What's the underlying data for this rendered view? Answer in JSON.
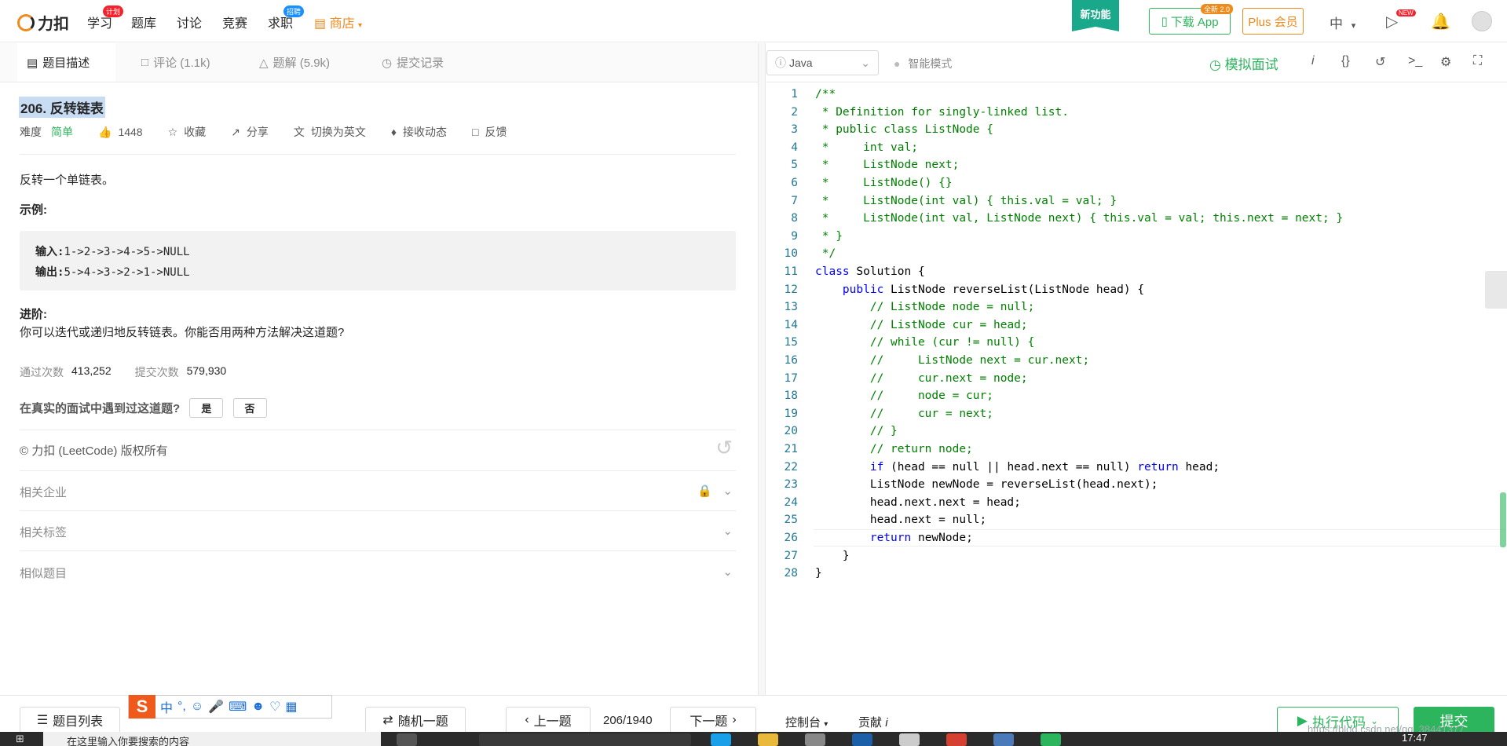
{
  "nav": {
    "logo": "力扣",
    "items": [
      {
        "label": "学习",
        "badge": "计划",
        "badge_color": "#f5222d"
      },
      {
        "label": "题库"
      },
      {
        "label": "讨论"
      },
      {
        "label": "竞赛"
      },
      {
        "label": "求职",
        "badge": "招聘",
        "badge_color": "#1890ff"
      }
    ],
    "shop": "商店",
    "new_feature": "新功能",
    "download_app": "下载 App",
    "download_badge": "全新 2.0",
    "plus": "Plus 会员",
    "language": "中",
    "new_badge": "NEW"
  },
  "tabs": [
    {
      "label": "题目描述",
      "icon": "description-icon"
    },
    {
      "label": "评论 (1.1k)",
      "icon": "comment-icon"
    },
    {
      "label": "题解 (5.9k)",
      "icon": "flask-icon"
    },
    {
      "label": "提交记录",
      "icon": "clock-icon"
    }
  ],
  "problem": {
    "title": "206. 反转链表",
    "difficulty_label": "难度",
    "difficulty": "简单",
    "likes": "1448",
    "actions": [
      "收藏",
      "分享",
      "切换为英文",
      "接收动态",
      "反馈"
    ],
    "description": "反转一个单链表。",
    "example_heading": "示例:",
    "input_label": "输入:",
    "input_value": "1->2->3->4->5->NULL",
    "output_label": "输出:",
    "output_value": "5->4->3->2->1->NULL",
    "advanced_heading": "进阶:",
    "advanced_text": "你可以迭代或递归地反转链表。你能否用两种方法解决这道题?",
    "accepted_label": "通过次数",
    "accepted_value": "413,252",
    "submissions_label": "提交次数",
    "submissions_value": "579,930",
    "interview_question": "在真实的面试中遇到过这道题?",
    "yes": "是",
    "no": "否",
    "copyright": "© 力扣 (LeetCode) 版权所有",
    "sections": [
      "相关企业",
      "相关标签",
      "相似题目"
    ]
  },
  "editor": {
    "language": "Java",
    "smart_mode": "智能模式",
    "mock_interview": "模拟面试",
    "lines": [
      [
        [
          "c-com",
          "/**"
        ]
      ],
      [
        [
          "c-com",
          " * Definition for singly-linked list."
        ]
      ],
      [
        [
          "c-com",
          " * public class ListNode {"
        ]
      ],
      [
        [
          "c-com",
          " *     int val;"
        ]
      ],
      [
        [
          "c-com",
          " *     ListNode next;"
        ]
      ],
      [
        [
          "c-com",
          " *     ListNode() {}"
        ]
      ],
      [
        [
          "c-com",
          " *     ListNode(int val) { this.val = val; }"
        ]
      ],
      [
        [
          "c-com",
          " *     ListNode(int val, ListNode next) { this.val = val; this.next = next; }"
        ]
      ],
      [
        [
          "c-com",
          " * }"
        ]
      ],
      [
        [
          "c-com",
          " */"
        ]
      ],
      [
        [
          "c-kw",
          "class"
        ],
        [
          "c-txt",
          " Solution {"
        ]
      ],
      [
        [
          "c-txt",
          "    "
        ],
        [
          "c-kw",
          "public"
        ],
        [
          "c-txt",
          " ListNode reverseList(ListNode head) {"
        ]
      ],
      [
        [
          "c-txt",
          "        "
        ],
        [
          "c-com",
          "// ListNode node = null;"
        ]
      ],
      [
        [
          "c-txt",
          "        "
        ],
        [
          "c-com",
          "// ListNode cur = head;"
        ]
      ],
      [
        [
          "c-txt",
          "        "
        ],
        [
          "c-com",
          "// while (cur != null) {"
        ]
      ],
      [
        [
          "c-txt",
          "        "
        ],
        [
          "c-com",
          "//     ListNode next = cur.next;"
        ]
      ],
      [
        [
          "c-txt",
          "        "
        ],
        [
          "c-com",
          "//     cur.next = node;"
        ]
      ],
      [
        [
          "c-txt",
          "        "
        ],
        [
          "c-com",
          "//     node = cur;"
        ]
      ],
      [
        [
          "c-txt",
          "        "
        ],
        [
          "c-com",
          "//     cur = next;"
        ]
      ],
      [
        [
          "c-txt",
          "        "
        ],
        [
          "c-com",
          "// }"
        ]
      ],
      [
        [
          "c-txt",
          "        "
        ],
        [
          "c-com",
          "// return node;"
        ]
      ],
      [
        [
          "c-txt",
          "        "
        ],
        [
          "c-kw",
          "if"
        ],
        [
          "c-txt",
          " (head == null || head.next == null) "
        ],
        [
          "c-kw",
          "return"
        ],
        [
          "c-txt",
          " head;"
        ]
      ],
      [
        [
          "c-txt",
          "        ListNode newNode = reverseList(head.next);"
        ]
      ],
      [
        [
          "c-txt",
          "        head.next.next = head;"
        ]
      ],
      [
        [
          "c-txt",
          "        head.next = null;"
        ]
      ],
      [
        [
          "c-txt",
          "        "
        ],
        [
          "c-kw",
          "return"
        ],
        [
          "c-txt",
          " newNode;"
        ]
      ],
      [
        [
          "c-txt",
          "    }"
        ]
      ],
      [
        [
          "c-txt",
          "}"
        ]
      ]
    ],
    "current_line": 26
  },
  "bottom": {
    "problem_list": "题目列表",
    "random": "随机一题",
    "prev": "上一题",
    "count": "206/1940",
    "next": "下一题",
    "console": "控制台",
    "contribute": "贡献",
    "run": "执行代码",
    "submit": "提交"
  },
  "ime": {
    "logo": "S",
    "mode": "中"
  },
  "taskbar": {
    "search_placeholder": "在这里输入你要搜索的内容",
    "time": "17:47"
  },
  "watermark": "https://blog.csdn.net/qq_38441377",
  "colors": {
    "accent": "#2db55d",
    "brand": "#ef8a1c"
  }
}
